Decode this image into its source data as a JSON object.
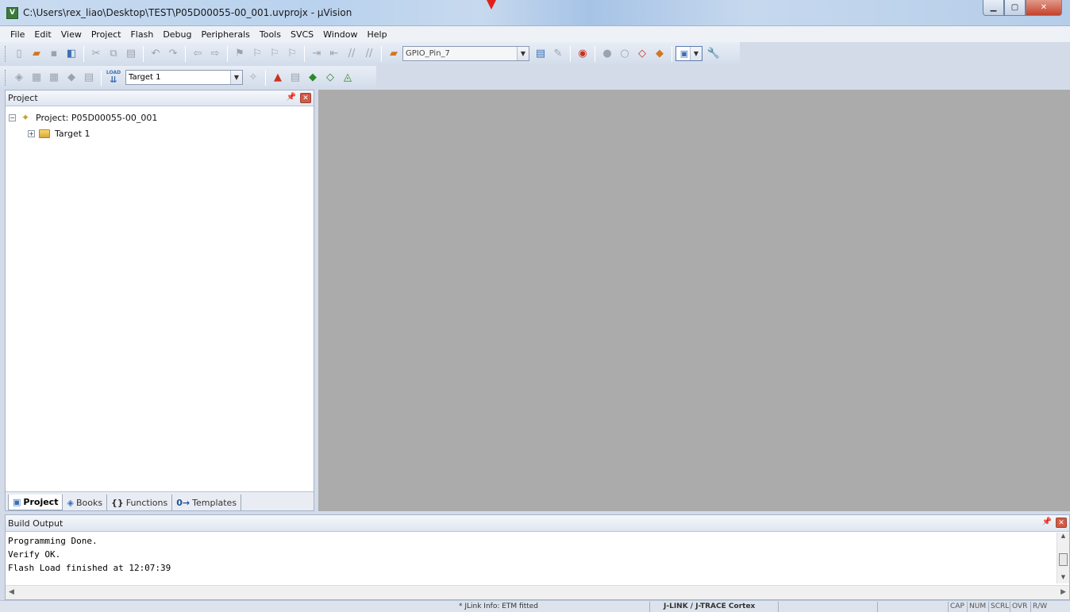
{
  "window": {
    "title": "C:\\Users\\rex_liao\\Desktop\\TEST\\P05D00055-00_001.uvprojx - µVision",
    "app_icon": "V",
    "minimize_icon": "minimize-icon",
    "maximize_icon": "maximize-icon",
    "close_icon": "close-icon"
  },
  "menu": [
    "File",
    "Edit",
    "View",
    "Project",
    "Flash",
    "Debug",
    "Peripherals",
    "Tools",
    "SVCS",
    "Window",
    "Help"
  ],
  "toolbar": {
    "find_combo_value": "GPIO_Pin_7",
    "target_combo_value": "Target 1",
    "load_label": "LOAD"
  },
  "project_panel": {
    "title": "Project",
    "root_label": "Project: P05D00055-00_001",
    "child_label": "Target 1",
    "tabs": [
      "Project",
      "Books",
      "Functions",
      "Templates"
    ]
  },
  "build_output": {
    "title": "Build Output",
    "lines": [
      "Programming Done.",
      "Verify OK.",
      "Flash Load finished at 12:07:39"
    ]
  },
  "statusbar": {
    "jlink_info": "* JLink Info: ETM fitted",
    "debugger": "J-LINK / J-TRACE Cortex",
    "indicators": [
      "CAP",
      "NUM",
      "SCRL",
      "OVR",
      "R/W"
    ]
  },
  "colors": {
    "editor_background": "#ababab",
    "close_button": "#c4422c",
    "drop_marker": "#e0201a"
  }
}
